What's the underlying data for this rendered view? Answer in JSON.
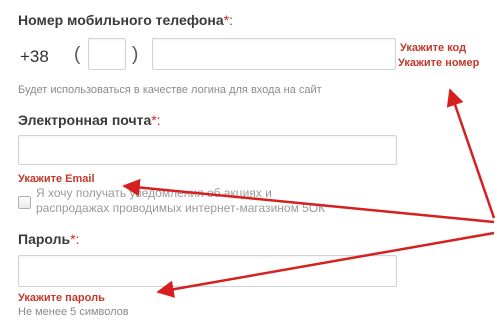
{
  "phone": {
    "label": "Номер мобильного телефона",
    "required_mark": "*:",
    "country_code": "+38",
    "paren_open": "(",
    "paren_close": ")",
    "code_value": "",
    "number_value": "",
    "hint": "Будет использоваться в качестве логина для входа на сайт",
    "error_code": "Укажите код",
    "error_number": "Укажите номер"
  },
  "email": {
    "label": "Электронная почта",
    "required_mark": "*:",
    "value": "",
    "error": "Укажите Email"
  },
  "newsletter": {
    "checked": false,
    "line1": "Я хочу получать уведомления об акциях и",
    "line2": "распродажах проводимых интернет-магазином 5ОК"
  },
  "password": {
    "label": "Пароль",
    "required_mark": "*:",
    "value": "",
    "error": "Укажите пароль",
    "hint": "Не менее 5 символов"
  },
  "colors": {
    "error_red": "#c0392b",
    "arrow_red": "#d62020",
    "input_border": "#cfd3d6"
  }
}
